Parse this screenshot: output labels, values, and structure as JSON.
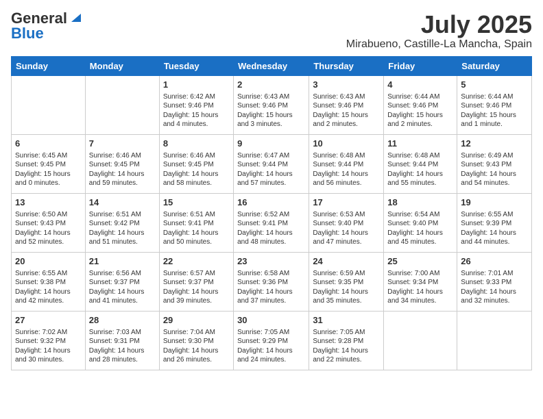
{
  "header": {
    "logo_general": "General",
    "logo_blue": "Blue",
    "title": "July 2025",
    "subtitle": "Mirabueno, Castille-La Mancha, Spain"
  },
  "days_of_week": [
    "Sunday",
    "Monday",
    "Tuesday",
    "Wednesday",
    "Thursday",
    "Friday",
    "Saturday"
  ],
  "weeks": [
    [
      {
        "day": "",
        "content": ""
      },
      {
        "day": "",
        "content": ""
      },
      {
        "day": "1",
        "content": "Sunrise: 6:42 AM\nSunset: 9:46 PM\nDaylight: 15 hours\nand 4 minutes."
      },
      {
        "day": "2",
        "content": "Sunrise: 6:43 AM\nSunset: 9:46 PM\nDaylight: 15 hours\nand 3 minutes."
      },
      {
        "day": "3",
        "content": "Sunrise: 6:43 AM\nSunset: 9:46 PM\nDaylight: 15 hours\nand 2 minutes."
      },
      {
        "day": "4",
        "content": "Sunrise: 6:44 AM\nSunset: 9:46 PM\nDaylight: 15 hours\nand 2 minutes."
      },
      {
        "day": "5",
        "content": "Sunrise: 6:44 AM\nSunset: 9:46 PM\nDaylight: 15 hours\nand 1 minute."
      }
    ],
    [
      {
        "day": "6",
        "content": "Sunrise: 6:45 AM\nSunset: 9:45 PM\nDaylight: 15 hours\nand 0 minutes."
      },
      {
        "day": "7",
        "content": "Sunrise: 6:46 AM\nSunset: 9:45 PM\nDaylight: 14 hours\nand 59 minutes."
      },
      {
        "day": "8",
        "content": "Sunrise: 6:46 AM\nSunset: 9:45 PM\nDaylight: 14 hours\nand 58 minutes."
      },
      {
        "day": "9",
        "content": "Sunrise: 6:47 AM\nSunset: 9:44 PM\nDaylight: 14 hours\nand 57 minutes."
      },
      {
        "day": "10",
        "content": "Sunrise: 6:48 AM\nSunset: 9:44 PM\nDaylight: 14 hours\nand 56 minutes."
      },
      {
        "day": "11",
        "content": "Sunrise: 6:48 AM\nSunset: 9:44 PM\nDaylight: 14 hours\nand 55 minutes."
      },
      {
        "day": "12",
        "content": "Sunrise: 6:49 AM\nSunset: 9:43 PM\nDaylight: 14 hours\nand 54 minutes."
      }
    ],
    [
      {
        "day": "13",
        "content": "Sunrise: 6:50 AM\nSunset: 9:43 PM\nDaylight: 14 hours\nand 52 minutes."
      },
      {
        "day": "14",
        "content": "Sunrise: 6:51 AM\nSunset: 9:42 PM\nDaylight: 14 hours\nand 51 minutes."
      },
      {
        "day": "15",
        "content": "Sunrise: 6:51 AM\nSunset: 9:41 PM\nDaylight: 14 hours\nand 50 minutes."
      },
      {
        "day": "16",
        "content": "Sunrise: 6:52 AM\nSunset: 9:41 PM\nDaylight: 14 hours\nand 48 minutes."
      },
      {
        "day": "17",
        "content": "Sunrise: 6:53 AM\nSunset: 9:40 PM\nDaylight: 14 hours\nand 47 minutes."
      },
      {
        "day": "18",
        "content": "Sunrise: 6:54 AM\nSunset: 9:40 PM\nDaylight: 14 hours\nand 45 minutes."
      },
      {
        "day": "19",
        "content": "Sunrise: 6:55 AM\nSunset: 9:39 PM\nDaylight: 14 hours\nand 44 minutes."
      }
    ],
    [
      {
        "day": "20",
        "content": "Sunrise: 6:55 AM\nSunset: 9:38 PM\nDaylight: 14 hours\nand 42 minutes."
      },
      {
        "day": "21",
        "content": "Sunrise: 6:56 AM\nSunset: 9:37 PM\nDaylight: 14 hours\nand 41 minutes."
      },
      {
        "day": "22",
        "content": "Sunrise: 6:57 AM\nSunset: 9:37 PM\nDaylight: 14 hours\nand 39 minutes."
      },
      {
        "day": "23",
        "content": "Sunrise: 6:58 AM\nSunset: 9:36 PM\nDaylight: 14 hours\nand 37 minutes."
      },
      {
        "day": "24",
        "content": "Sunrise: 6:59 AM\nSunset: 9:35 PM\nDaylight: 14 hours\nand 35 minutes."
      },
      {
        "day": "25",
        "content": "Sunrise: 7:00 AM\nSunset: 9:34 PM\nDaylight: 14 hours\nand 34 minutes."
      },
      {
        "day": "26",
        "content": "Sunrise: 7:01 AM\nSunset: 9:33 PM\nDaylight: 14 hours\nand 32 minutes."
      }
    ],
    [
      {
        "day": "27",
        "content": "Sunrise: 7:02 AM\nSunset: 9:32 PM\nDaylight: 14 hours\nand 30 minutes."
      },
      {
        "day": "28",
        "content": "Sunrise: 7:03 AM\nSunset: 9:31 PM\nDaylight: 14 hours\nand 28 minutes."
      },
      {
        "day": "29",
        "content": "Sunrise: 7:04 AM\nSunset: 9:30 PM\nDaylight: 14 hours\nand 26 minutes."
      },
      {
        "day": "30",
        "content": "Sunrise: 7:05 AM\nSunset: 9:29 PM\nDaylight: 14 hours\nand 24 minutes."
      },
      {
        "day": "31",
        "content": "Sunrise: 7:05 AM\nSunset: 9:28 PM\nDaylight: 14 hours\nand 22 minutes."
      },
      {
        "day": "",
        "content": ""
      },
      {
        "day": "",
        "content": ""
      }
    ]
  ]
}
